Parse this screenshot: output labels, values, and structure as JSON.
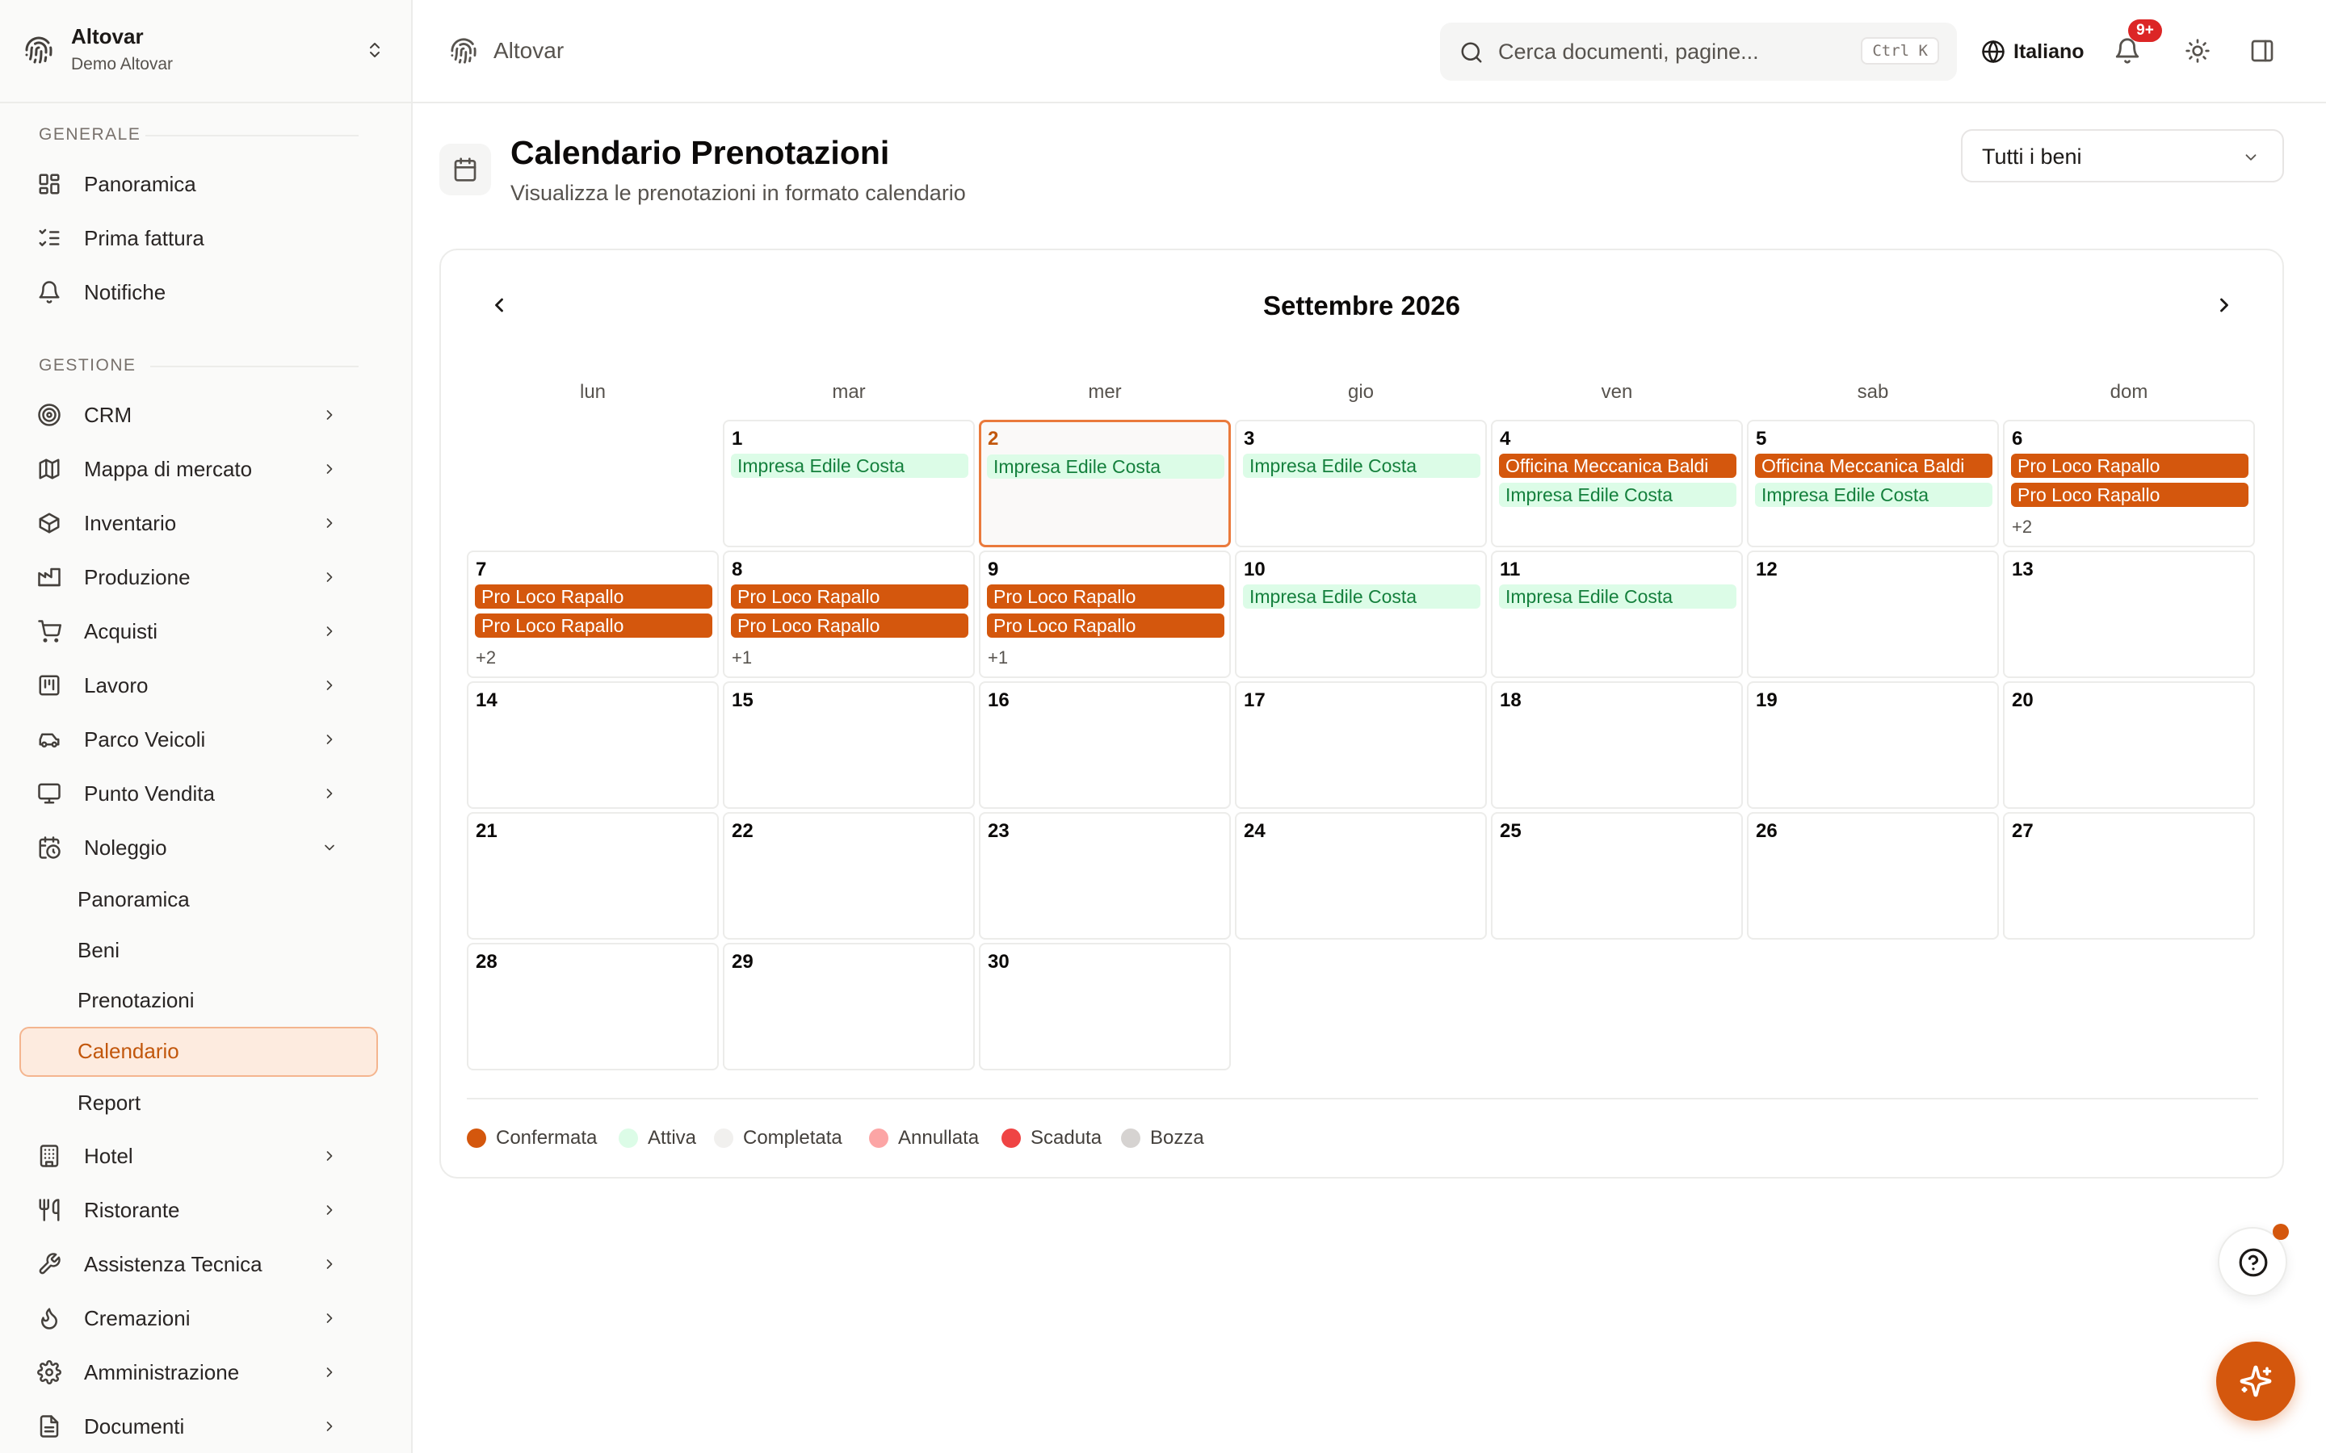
{
  "org": {
    "name": "Altovar",
    "subtitle": "Demo Altovar"
  },
  "sidebar": {
    "section_general": "GENERALE",
    "general_items": [
      {
        "label": "Panoramica",
        "icon": "grid-icon"
      },
      {
        "label": "Prima fattura",
        "icon": "checklist-icon"
      },
      {
        "label": "Notifiche",
        "icon": "bell-icon"
      }
    ],
    "section_management": "GESTIONE",
    "management_items": [
      {
        "label": "CRM",
        "icon": "target-icon"
      },
      {
        "label": "Mappa di mercato",
        "icon": "map-icon"
      },
      {
        "label": "Inventario",
        "icon": "box-icon"
      },
      {
        "label": "Produzione",
        "icon": "factory-icon"
      },
      {
        "label": "Acquisti",
        "icon": "cart-icon"
      },
      {
        "label": "Lavoro",
        "icon": "kanban-icon"
      },
      {
        "label": "Parco Veicoli",
        "icon": "car-icon"
      },
      {
        "label": "Punto Vendita",
        "icon": "monitor-icon"
      },
      {
        "label": "Noleggio",
        "icon": "calendar-clock-icon"
      }
    ],
    "rental_sub_items": [
      {
        "label": "Panoramica"
      },
      {
        "label": "Beni"
      },
      {
        "label": "Prenotazioni"
      },
      {
        "label": "Calendario",
        "active": true
      },
      {
        "label": "Report"
      }
    ],
    "more_items": [
      {
        "label": "Hotel",
        "icon": "building-icon"
      },
      {
        "label": "Ristorante",
        "icon": "utensils-icon"
      },
      {
        "label": "Assistenza Tecnica",
        "icon": "wrench-icon"
      },
      {
        "label": "Cremazioni",
        "icon": "flame-icon"
      },
      {
        "label": "Amministrazione",
        "icon": "gear-icon"
      },
      {
        "label": "Documenti",
        "icon": "document-icon"
      }
    ]
  },
  "topbar": {
    "breadcrumb": "Altovar",
    "search_placeholder": "Cerca documenti, pagine...",
    "search_shortcut": "Ctrl K",
    "language": "Italiano",
    "notification_count": "9+"
  },
  "page": {
    "title": "Calendario Prenotazioni",
    "subtitle": "Visualizza le prenotazioni in formato calendario",
    "asset_filter": "Tutti i beni"
  },
  "calendar": {
    "month_label": "Settembre 2026",
    "weekdays": [
      "lun",
      "mar",
      "mer",
      "gio",
      "ven",
      "sab",
      "dom"
    ],
    "today": 2,
    "days": [
      {
        "day": "1",
        "events": [
          {
            "label": "Impresa Edile Costa",
            "status": "Attiva"
          }
        ]
      },
      {
        "day": "2",
        "events": [
          {
            "label": "Impresa Edile Costa",
            "status": "Attiva"
          }
        ]
      },
      {
        "day": "3",
        "events": [
          {
            "label": "Impresa Edile Costa",
            "status": "Attiva"
          }
        ]
      },
      {
        "day": "4",
        "events": [
          {
            "label": "Officina Meccanica Baldi",
            "status": "Confermata"
          },
          {
            "label": "Impresa Edile Costa",
            "status": "Attiva"
          }
        ]
      },
      {
        "day": "5",
        "events": [
          {
            "label": "Officina Meccanica Baldi",
            "status": "Confermata"
          },
          {
            "label": "Impresa Edile Costa",
            "status": "Attiva"
          }
        ]
      },
      {
        "day": "6",
        "events": [
          {
            "label": "Pro Loco Rapallo",
            "status": "Confermata"
          },
          {
            "label": "Pro Loco Rapallo",
            "status": "Confermata"
          }
        ],
        "more": "+2"
      },
      {
        "day": "7",
        "events": [
          {
            "label": "Pro Loco Rapallo",
            "status": "Confermata"
          },
          {
            "label": "Pro Loco Rapallo",
            "status": "Confermata"
          }
        ],
        "more": "+2"
      },
      {
        "day": "8",
        "events": [
          {
            "label": "Pro Loco Rapallo",
            "status": "Confermata"
          },
          {
            "label": "Pro Loco Rapallo",
            "status": "Confermata"
          }
        ],
        "more": "+1"
      },
      {
        "day": "9",
        "events": [
          {
            "label": "Pro Loco Rapallo",
            "status": "Confermata"
          },
          {
            "label": "Pro Loco Rapallo",
            "status": "Confermata"
          }
        ],
        "more": "+1"
      },
      {
        "day": "10",
        "events": [
          {
            "label": "Impresa Edile Costa",
            "status": "Attiva"
          }
        ]
      },
      {
        "day": "11",
        "events": [
          {
            "label": "Impresa Edile Costa",
            "status": "Attiva"
          }
        ]
      },
      {
        "day": "12",
        "events": []
      },
      {
        "day": "13",
        "events": []
      },
      {
        "day": "14",
        "events": []
      },
      {
        "day": "15",
        "events": []
      },
      {
        "day": "16",
        "events": []
      },
      {
        "day": "17",
        "events": []
      },
      {
        "day": "18",
        "events": []
      },
      {
        "day": "19",
        "events": []
      },
      {
        "day": "20",
        "events": []
      },
      {
        "day": "21",
        "events": []
      },
      {
        "day": "22",
        "events": []
      },
      {
        "day": "23",
        "events": []
      },
      {
        "day": "24",
        "events": []
      },
      {
        "day": "25",
        "events": []
      },
      {
        "day": "26",
        "events": []
      },
      {
        "day": "27",
        "events": []
      },
      {
        "day": "28",
        "events": []
      },
      {
        "day": "29",
        "events": []
      },
      {
        "day": "30",
        "events": []
      }
    ]
  },
  "legend": [
    {
      "label": "Confermata",
      "color": "#d4570d"
    },
    {
      "label": "Attiva",
      "color": "#dcfce7"
    },
    {
      "label": "Completata",
      "color": "#f1f0ee"
    },
    {
      "label": "Annullata",
      "color": "#fca5a5"
    },
    {
      "label": "Scaduta",
      "color": "#ef4444"
    },
    {
      "label": "Bozza",
      "color": "#d6d3d1"
    }
  ],
  "colors": {
    "accent": "#d4570d",
    "active_bg": "#dcfce7",
    "active_text": "#15803d"
  }
}
